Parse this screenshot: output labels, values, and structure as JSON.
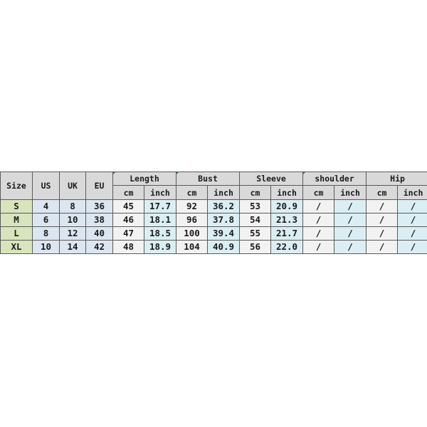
{
  "table": {
    "headers": {
      "size": "Size",
      "us": "US",
      "uk": "UK",
      "eu": "EU",
      "groups": [
        "Length",
        "Bust",
        "Sleeve",
        "shoulder",
        "Hip"
      ],
      "units": [
        "cm",
        "inch",
        "cm",
        "inch",
        "cm",
        "inch",
        "cm",
        "inch",
        "cm",
        "inch"
      ]
    },
    "rows": [
      {
        "size": "S",
        "us": "4",
        "uk": "8",
        "eu": "36",
        "length_cm": "45",
        "length_inch": "17.7",
        "bust_cm": "92",
        "bust_inch": "36.2",
        "sleeve_cm": "53",
        "sleeve_inch": "20.9",
        "shoulder_cm": "/",
        "shoulder_inch": "/",
        "hip_cm": "/",
        "hip_inch": "/"
      },
      {
        "size": "M",
        "us": "6",
        "uk": "10",
        "eu": "38",
        "length_cm": "46",
        "length_inch": "18.1",
        "bust_cm": "96",
        "bust_inch": "37.8",
        "sleeve_cm": "54",
        "sleeve_inch": "21.3",
        "shoulder_cm": "/",
        "shoulder_inch": "/",
        "hip_cm": "/",
        "hip_inch": "/"
      },
      {
        "size": "L",
        "us": "8",
        "uk": "12",
        "eu": "40",
        "length_cm": "47",
        "length_inch": "18.5",
        "bust_cm": "100",
        "bust_inch": "39.4",
        "sleeve_cm": "55",
        "sleeve_inch": "21.7",
        "shoulder_cm": "/",
        "shoulder_inch": "/",
        "hip_cm": "/",
        "hip_inch": "/"
      },
      {
        "size": "XL",
        "us": "10",
        "uk": "14",
        "eu": "42",
        "length_cm": "48",
        "length_inch": "18.9",
        "bust_cm": "104",
        "bust_inch": "40.9",
        "sleeve_cm": "56",
        "sleeve_inch": "22.0",
        "shoulder_cm": "/",
        "shoulder_inch": "/",
        "hip_cm": "/",
        "hip_inch": "/"
      }
    ]
  },
  "colors": {
    "header_bg": "#d9d9d9",
    "size_col_bg": "#d8e4bc",
    "region_col_bg": "#dce6f1",
    "cm_col_bg": "#f2f2f2",
    "inch_col_bg": "#daeef3"
  }
}
